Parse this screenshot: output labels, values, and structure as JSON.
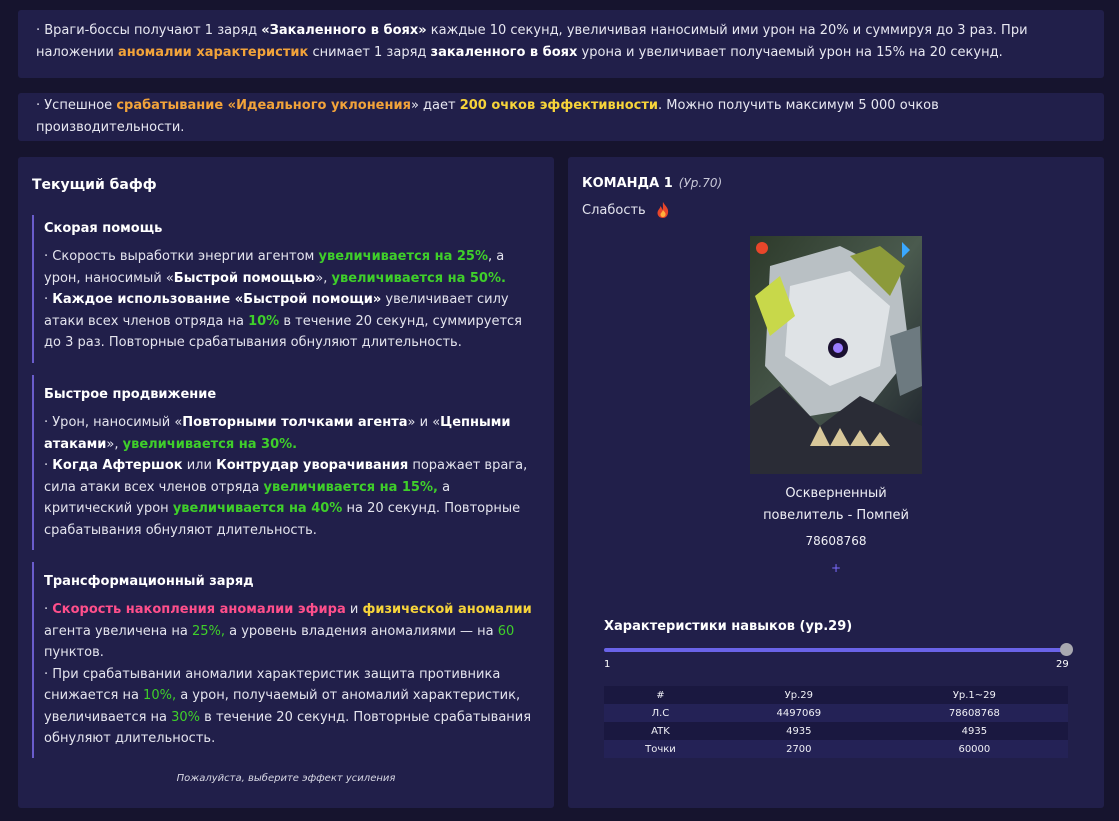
{
  "notes": {
    "n1": {
      "t1": "· Враги-боссы получают 1 заряд ",
      "t2": "«Закаленного в боях»",
      "t3": " каждые 10 секунд, увеличивая наносимый ими урон на 20% и суммируя до 3 раз. При наложении ",
      "t4": "аномалии характеристик",
      "t5": " снимает 1 заряд ",
      "t6": "закаленного в боях",
      "t7": " урона и увеличивает получаемый урон на 15% на 20 секунд."
    },
    "n2": {
      "t1": "· Успешное ",
      "t2": "срабатывание «Идеального уклонения",
      "t3": "» дает ",
      "t4": "200 очков эффективности",
      "t5": ". Можно получить максимум 5 000 очков производительности."
    }
  },
  "left": {
    "title": "Текущий бафф",
    "hint": "Пожалуйста, выберите эффект усиления",
    "buff1": {
      "name": "Скорая помощь",
      "a1": "· Скорость выработки энергии агентом ",
      "a2": "увеличивается на 25%",
      "a3": ", а урон, наносимый «",
      "a4": "Быстрой помощью",
      "a5": "», ",
      "a6": "увеличивается на 50%.",
      "b0": "· ",
      "b1": "Каждое использование «Быстрой помощи»",
      "b2": " увеличивает силу атаки всех членов отряда на ",
      "b3": "10%",
      "b4": " в течение 20 секунд, суммируется до 3 раз. Повторные срабатывания обнуляют длительность."
    },
    "buff2": {
      "name": "Быстрое продвижение",
      "a1": "· Урон, наносимый «",
      "a2": "Повторными толчками агента",
      "a3": "» и «",
      "a4": "Цепными атаками",
      "a5": "», ",
      "a6": "увеличивается на 30%.",
      "b0": "· ",
      "b1": "Когда Афтершок",
      "b2": " или ",
      "b3": "Контрудар уворачивания",
      "b4": " поражает врага, сила атаки всех членов отряда ",
      "b5": "увеличивается на 15%,",
      "b6": " а критический урон ",
      "b7": "увеличивается на 40%",
      "b8": " на 20 секунд. Повторные срабатывания обнуляют длительность."
    },
    "buff3": {
      "name": "Трансформационный заряд",
      "a0": "· ",
      "a1": "Скорость накопления аномалии эфира",
      "a2": " и ",
      "a3": "физической аномалии",
      "a4": " агента увеличена на ",
      "a5": "25%,",
      "a6": " а уровень владения аномалиями — на ",
      "a7": "60",
      "a8": " пунктов.",
      "b1": "· При срабатывании аномалии характеристик защита противника снижается на ",
      "b2": "10%,",
      "b3": " а урон, получаемый от аномалий характеристик, увеличивается на ",
      "b4": "30%",
      "b5": " в течение 20 секунд. Повторные срабатывания обнуляют длительность."
    }
  },
  "right": {
    "team": "КОМАНДА 1",
    "level": "(Ур.70)",
    "weakness": "Слабость",
    "weakness_icon": "fire-icon",
    "boss_name_line1": "Оскверненный",
    "boss_name_line2": "повелитель - Помпей",
    "boss_hp": "78608768",
    "plus": "+",
    "skills_title": "Характеристики навыков (ур.29)",
    "slider": {
      "min": "1",
      "max": "29",
      "value": 29
    },
    "table": {
      "headers": [
        "#",
        "Ур.29",
        "Ур.1~29"
      ],
      "rows": [
        [
          "Л.С",
          "4497069",
          "78608768"
        ],
        [
          "ATK",
          "4935",
          "4935"
        ],
        [
          "Точки",
          "2700",
          "60000"
        ]
      ]
    }
  },
  "colors": {
    "accent_orange": "#f2a33a",
    "accent_green": "#3fcf2a",
    "accent_pink": "#ff4f8b",
    "accent_yellow": "#f7d43a",
    "slider": "#6a63e8"
  }
}
